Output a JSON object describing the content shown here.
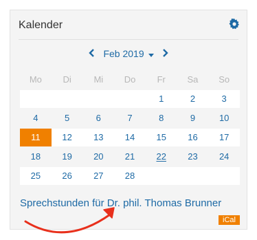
{
  "calendar": {
    "title": "Kalender",
    "month_label": "Feb 2019",
    "weekdays": [
      "Mo",
      "Di",
      "Mi",
      "Do",
      "Fr",
      "Sa",
      "So"
    ],
    "weeks": [
      [
        "",
        "",
        "",
        "",
        "1",
        "2",
        "3"
      ],
      [
        "4",
        "5",
        "6",
        "7",
        "8",
        "9",
        "10"
      ],
      [
        "11",
        "12",
        "13",
        "14",
        "15",
        "16",
        "17"
      ],
      [
        "18",
        "19",
        "20",
        "21",
        "22",
        "23",
        "24"
      ],
      [
        "25",
        "26",
        "27",
        "28",
        "",
        "",
        ""
      ]
    ],
    "highlighted_day": "11",
    "underlined_day": "22",
    "office_hours_link": "Sprechstunden für Dr. phil. Thomas Brunner",
    "ical_label": "iCal"
  },
  "icons": {
    "settings": "gear-icon",
    "prev": "chevron-left-icon",
    "next": "chevron-right-icon",
    "dropdown": "caret-down-icon",
    "annotation": "arrow-annotation"
  },
  "colors": {
    "link": "#1e6aa5",
    "today": "#f08000",
    "ical": "#f08000",
    "annotation_arrow": "#e8301c",
    "card_bg": "#f4f4f4"
  }
}
